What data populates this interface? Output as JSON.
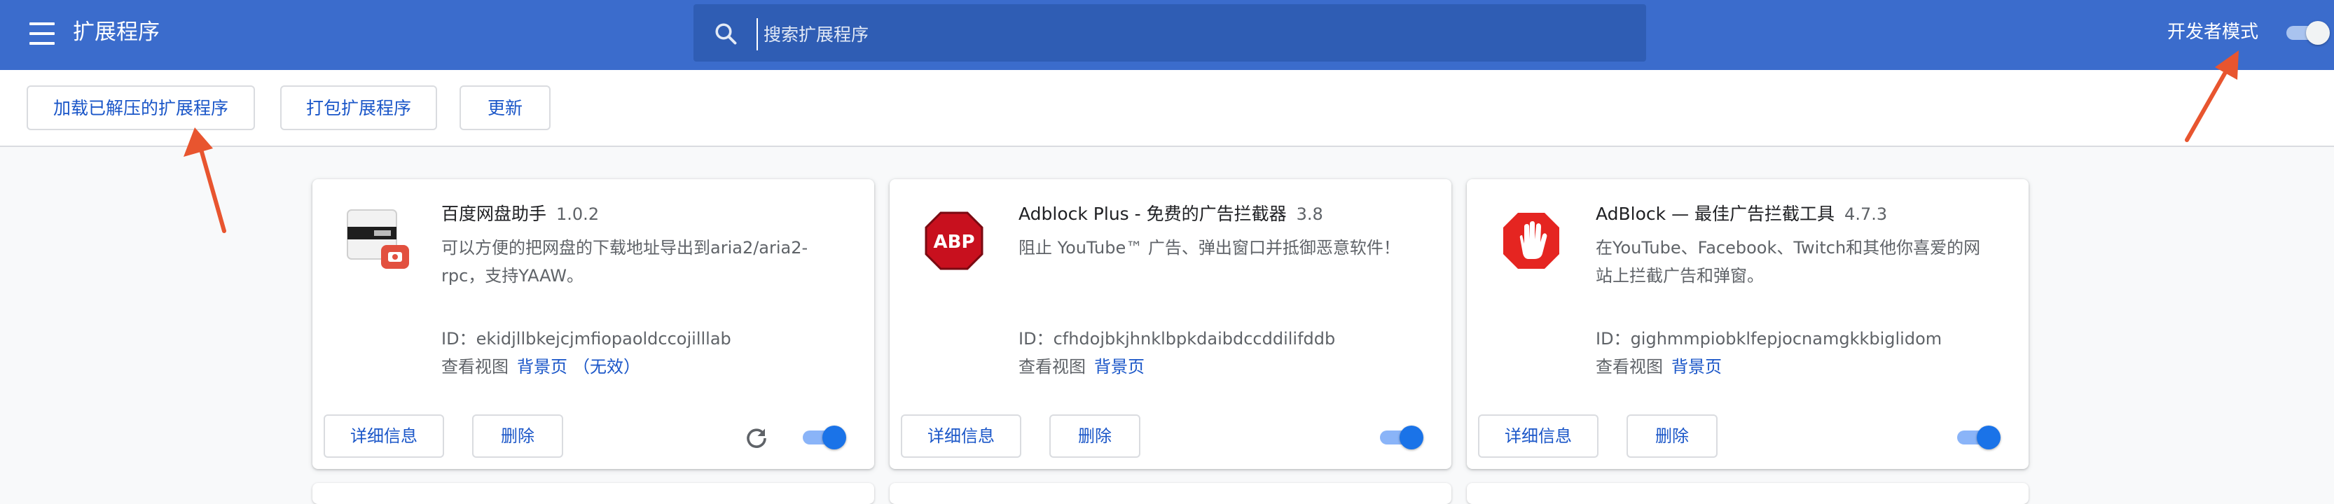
{
  "header": {
    "title": "扩展程序",
    "search_placeholder": "搜索扩展程序",
    "developer_mode_label": "开发者模式",
    "developer_mode_on": true
  },
  "toolbar": {
    "load_unpacked": "加载已解压的扩展程序",
    "pack_extension": "打包扩展程序",
    "update": "更新"
  },
  "extensions": [
    {
      "name": "百度网盘助手",
      "version": "1.0.2",
      "description": "可以方便的把网盘的下载地址导出到aria2/aria2-rpc，支持YAAW。",
      "id_label": "ID：",
      "id": "ekidjllbkejcjmfiopaoldccojilllab",
      "views_label": "查看视图",
      "views_link": "背景页",
      "views_note": "（无效）",
      "details_label": "详细信息",
      "remove_label": "删除",
      "enabled": true
    },
    {
      "name": "Adblock Plus - 免费的广告拦截器",
      "version": "3.8",
      "description": "阻止 YouTube™ 广告、弹出窗口并抵御恶意软件！",
      "id_label": "ID：",
      "id": "cfhdojbkjhnklbpkdaibdccddilifddb",
      "views_label": "查看视图",
      "views_link": "背景页",
      "details_label": "详细信息",
      "remove_label": "删除",
      "icon_text": "ABP",
      "enabled": true
    },
    {
      "name": "AdBlock — 最佳广告拦截工具",
      "version": "4.7.3",
      "description": "在YouTube、Facebook、Twitch和其他你喜爱的网站上拦截广告和弹窗。",
      "id_label": "ID：",
      "id": "gighmmpiobklfepjocnamgkkbiglidom",
      "views_label": "查看视图",
      "views_link": "背景页",
      "details_label": "详细信息",
      "remove_label": "删除",
      "enabled": true
    }
  ],
  "colors": {
    "header_bg": "#3b6ccc",
    "accent": "#1a73e8",
    "link": "#1a56c8",
    "annotation_arrow": "#e8552f"
  }
}
